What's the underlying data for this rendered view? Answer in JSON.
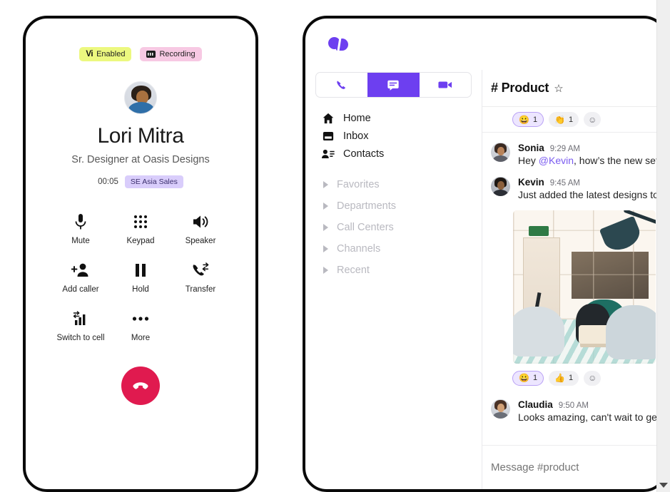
{
  "call_screen": {
    "badges": [
      {
        "id": "vi-enabled",
        "label": "Enabled",
        "mark": "Vi",
        "color": "#ecf87f"
      },
      {
        "id": "recording",
        "label": "Recording",
        "mark": "rec-icon",
        "color": "#f7c9e3"
      }
    ],
    "caller_name": "Lori Mitra",
    "caller_title": "Sr. Designer at Oasis Designs",
    "timer": "00:05",
    "line_badge": "SE Asia Sales",
    "controls": [
      {
        "label": "Mute",
        "icon": "microphone-icon"
      },
      {
        "label": "Keypad",
        "icon": "keypad-icon"
      },
      {
        "label": "Speaker",
        "icon": "speaker-icon"
      },
      {
        "label": "Add caller",
        "icon": "add-person-icon"
      },
      {
        "label": "Hold",
        "icon": "pause-icon"
      },
      {
        "label": "Transfer",
        "icon": "call-transfer-icon"
      },
      {
        "label": "Switch to cell",
        "icon": "switch-to-cell-icon"
      },
      {
        "label": "More",
        "icon": "ellipsis-icon"
      }
    ],
    "end_call": {
      "icon": "end-call-icon",
      "color": "#e01a4f"
    }
  },
  "chat_app": {
    "logo": "dialpad-logo",
    "accent_color": "#6d3ff0",
    "mode_tabs": [
      {
        "id": "calls",
        "icon": "phone-icon",
        "active": false
      },
      {
        "id": "chat",
        "icon": "chat-icon",
        "active": true
      },
      {
        "id": "video",
        "icon": "video-icon",
        "active": false
      }
    ],
    "nav_items": [
      {
        "label": "Home",
        "icon": "home-icon"
      },
      {
        "label": "Inbox",
        "icon": "inbox-icon"
      },
      {
        "label": "Contacts",
        "icon": "contacts-icon"
      }
    ],
    "nav_groups": [
      {
        "label": "Favorites"
      },
      {
        "label": "Departments"
      },
      {
        "label": "Call Centers"
      },
      {
        "label": "Channels"
      },
      {
        "label": "Recent"
      }
    ],
    "channel": {
      "hash": "#",
      "name": "Product",
      "star": "☆"
    },
    "top_reactions": [
      {
        "emoji": "😀",
        "count": "1",
        "selected": true
      },
      {
        "emoji": "👏",
        "count": "1",
        "selected": false
      },
      {
        "emoji": "☺",
        "count": "",
        "add": true
      }
    ],
    "messages": [
      {
        "author": "Sonia",
        "time": "9:29 AM",
        "text_before": "Hey ",
        "mention": "@Kevin",
        "text_after": ", how’s the new set"
      },
      {
        "author": "Kevin",
        "time": "9:45 AM",
        "text_before": "Just added the latest designs to",
        "mention": "",
        "text_after": ""
      },
      {
        "author": "Claudia",
        "time": "9:50 AM",
        "text_before": "Looks amazing, can't wait to ge",
        "mention": "",
        "text_after": ""
      }
    ],
    "photo_reactions": [
      {
        "emoji": "😀",
        "count": "1",
        "selected": true
      },
      {
        "emoji": "👍",
        "count": "1",
        "selected": false
      },
      {
        "emoji": "☺",
        "count": "",
        "add": true
      }
    ],
    "attachment_alt": "office-lounge-photo",
    "composer_placeholder": "Message #product"
  },
  "scrollbar": {
    "arrow": "chevron-down-icon"
  }
}
